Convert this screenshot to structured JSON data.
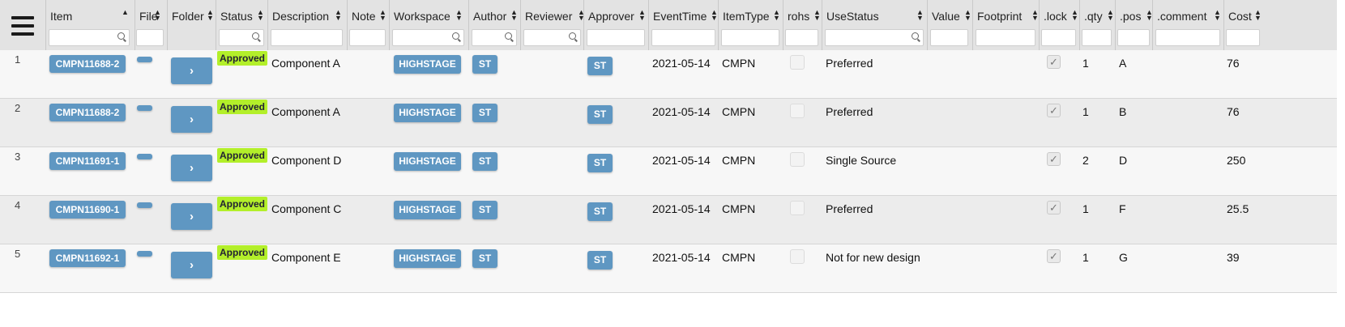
{
  "columns": [
    {
      "key": "item",
      "label": "Item"
    },
    {
      "key": "file",
      "label": "File"
    },
    {
      "key": "folder",
      "label": "Folder"
    },
    {
      "key": "status",
      "label": "Status"
    },
    {
      "key": "description",
      "label": "Description"
    },
    {
      "key": "note",
      "label": "Note"
    },
    {
      "key": "workspace",
      "label": "Workspace"
    },
    {
      "key": "author",
      "label": "Author"
    },
    {
      "key": "reviewer",
      "label": "Reviewer"
    },
    {
      "key": "approver",
      "label": "Approver"
    },
    {
      "key": "eventtime",
      "label": "EventTime"
    },
    {
      "key": "itemtype",
      "label": "ItemType"
    },
    {
      "key": "rohs",
      "label": "rohs"
    },
    {
      "key": "usestatus",
      "label": "UseStatus"
    },
    {
      "key": "value",
      "label": "Value"
    },
    {
      "key": "footprint",
      "label": "Footprint"
    },
    {
      "key": "lock",
      "label": ".lock"
    },
    {
      "key": "qty",
      "label": ".qty"
    },
    {
      "key": "pos",
      "label": ".pos"
    },
    {
      "key": "comment",
      "label": ".comment"
    },
    {
      "key": "cost",
      "label": "Cost"
    }
  ],
  "icons": {
    "menu": "hamburger-menu-icon",
    "search": "search-icon",
    "sort": "sort-icon",
    "chevron": "chevron-right-icon",
    "check": "checkmark-icon"
  },
  "glyphs": {
    "chevron": "›",
    "check": "✓",
    "sort_up": "▲",
    "sort_down": "▼"
  },
  "colors": {
    "button_blue": "#5f97c2",
    "approved_green": "#b3ef2a",
    "header_bg": "#e3e3e3"
  },
  "rows": [
    {
      "num": "1",
      "item": "CMPN11688-2",
      "status": "Approved",
      "description": "Component A",
      "workspace": "HIGHSTAGE",
      "author": "ST",
      "approver": "ST",
      "eventtime": "2021-05-14",
      "itemtype": "CMPN",
      "rohs": false,
      "usestatus": "Preferred",
      "lock": true,
      "qty": "1",
      "pos": "A",
      "cost": "76"
    },
    {
      "num": "2",
      "item": "CMPN11688-2",
      "status": "Approved",
      "description": "Component A",
      "workspace": "HIGHSTAGE",
      "author": "ST",
      "approver": "ST",
      "eventtime": "2021-05-14",
      "itemtype": "CMPN",
      "rohs": false,
      "usestatus": "Preferred",
      "lock": true,
      "qty": "1",
      "pos": "B",
      "cost": "76"
    },
    {
      "num": "3",
      "item": "CMPN11691-1",
      "status": "Approved",
      "description": "Component D",
      "workspace": "HIGHSTAGE",
      "author": "ST",
      "approver": "ST",
      "eventtime": "2021-05-14",
      "itemtype": "CMPN",
      "rohs": false,
      "usestatus": "Single Source",
      "lock": true,
      "qty": "2",
      "pos": "D",
      "cost": "250"
    },
    {
      "num": "4",
      "item": "CMPN11690-1",
      "status": "Approved",
      "description": "Component C",
      "workspace": "HIGHSTAGE",
      "author": "ST",
      "approver": "ST",
      "eventtime": "2021-05-14",
      "itemtype": "CMPN",
      "rohs": false,
      "usestatus": "Preferred",
      "lock": true,
      "qty": "1",
      "pos": "F",
      "cost": "25.5"
    },
    {
      "num": "5",
      "item": "CMPN11692-1",
      "status": "Approved",
      "description": "Component E",
      "workspace": "HIGHSTAGE",
      "author": "ST",
      "approver": "ST",
      "eventtime": "2021-05-14",
      "itemtype": "CMPN",
      "rohs": false,
      "usestatus": "Not for new design",
      "lock": true,
      "qty": "1",
      "pos": "G",
      "cost": "39"
    }
  ]
}
